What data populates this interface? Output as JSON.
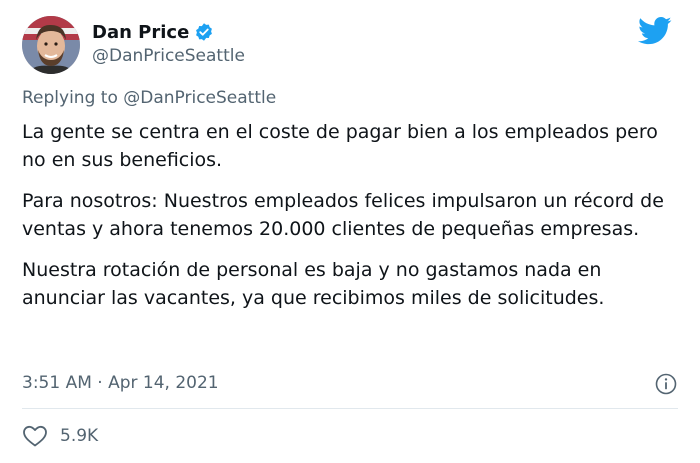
{
  "author": {
    "display_name": "Dan Price",
    "handle": "@DanPriceSeattle",
    "verified": true,
    "avatar": "avatar-portrait"
  },
  "reply": {
    "prefix": "Replying to",
    "handle": "@DanPriceSeattle"
  },
  "body": {
    "paragraphs": [
      "La gente se centra en el coste de pagar bien a los empleados pero no en sus beneficios.",
      "Para nosotros: Nuestros empleados felices impulsaron un récord de ventas y ahora tenemos 20.000 clientes de pequeñas empresas.",
      "Nuestra rotación de personal es baja y no gastamos nada en anunciar las vacantes, ya que recibimos miles de solicitudes."
    ]
  },
  "meta": {
    "timestamp": "3:51 AM · Apr 14, 2021"
  },
  "engagement": {
    "likes": "5.9K"
  },
  "icons": {
    "brand": "twitter-bird-icon",
    "verified": "verified-badge-icon",
    "info": "info-icon",
    "like": "heart-icon"
  },
  "colors": {
    "brand": "#1da1f2",
    "text": "#0f1419",
    "secondary": "#536471",
    "divider": "#e1e8ed"
  }
}
